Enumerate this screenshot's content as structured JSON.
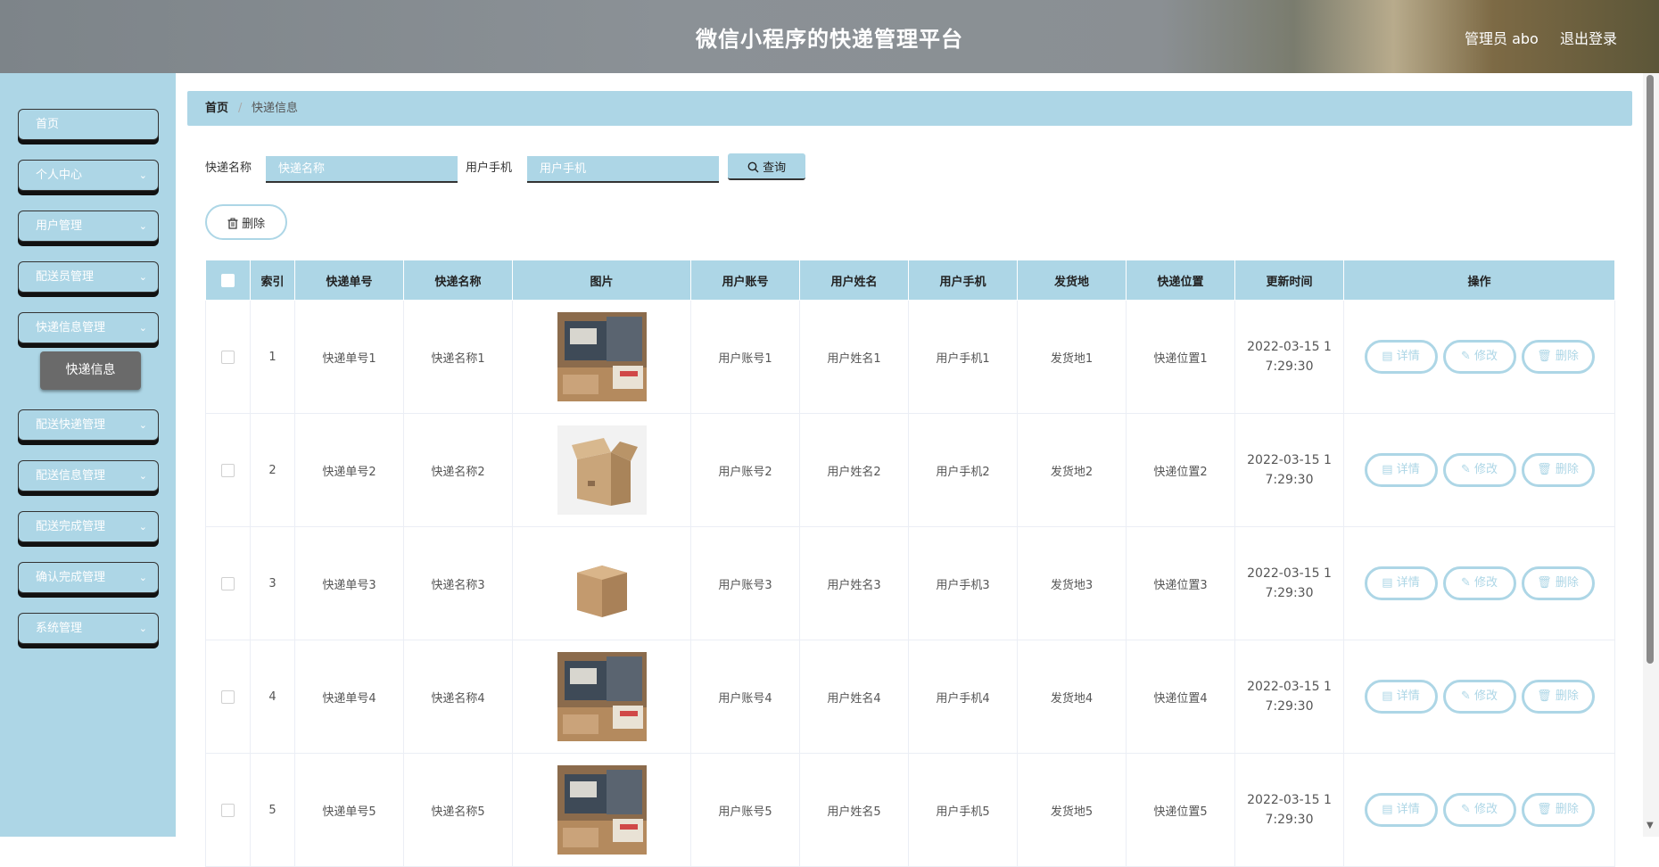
{
  "header": {
    "title": "微信小程序的快递管理平台",
    "admin_label": "管理员 abo",
    "logout_label": "退出登录"
  },
  "sidebar": {
    "items": [
      {
        "label": "首页",
        "has_children": false
      },
      {
        "label": "个人中心",
        "has_children": true
      },
      {
        "label": "用户管理",
        "has_children": true
      },
      {
        "label": "配送员管理",
        "has_children": true
      },
      {
        "label": "快递信息管理",
        "has_children": true
      },
      {
        "label": "配送快递管理",
        "has_children": true
      },
      {
        "label": "配送信息管理",
        "has_children": true
      },
      {
        "label": "配送完成管理",
        "has_children": true
      },
      {
        "label": "确认完成管理",
        "has_children": true
      },
      {
        "label": "系统管理",
        "has_children": true
      }
    ],
    "active_sub_item": "快递信息"
  },
  "breadcrumb": {
    "home": "首页",
    "separator": "/",
    "current": "快递信息"
  },
  "search": {
    "name_label": "快递名称",
    "name_placeholder": "快递名称",
    "phone_label": "用户手机",
    "phone_placeholder": "用户手机",
    "query_label": "查询"
  },
  "actions": {
    "delete_label": "删除"
  },
  "table": {
    "headers": [
      "索引",
      "快递单号",
      "快递名称",
      "图片",
      "用户账号",
      "用户姓名",
      "用户手机",
      "发货地",
      "快递位置",
      "更新时间",
      "操作"
    ],
    "rows": [
      {
        "index": "1",
        "number": "快递单号1",
        "name": "快递名称1",
        "image": "parcel-photo",
        "account": "用户账号1",
        "username": "用户姓名1",
        "phone": "用户手机1",
        "origin": "发货地1",
        "location": "快递位置1",
        "time_a": "2022-03-15 1",
        "time_b": "7:29:30"
      },
      {
        "index": "2",
        "number": "快递单号2",
        "name": "快递名称2",
        "image": "box-open",
        "account": "用户账号2",
        "username": "用户姓名2",
        "phone": "用户手机2",
        "origin": "发货地2",
        "location": "快递位置2",
        "time_a": "2022-03-15 1",
        "time_b": "7:29:30"
      },
      {
        "index": "3",
        "number": "快递单号3",
        "name": "快递名称3",
        "image": "box-closed",
        "account": "用户账号3",
        "username": "用户姓名3",
        "phone": "用户手机3",
        "origin": "发货地3",
        "location": "快递位置3",
        "time_a": "2022-03-15 1",
        "time_b": "7:29:30"
      },
      {
        "index": "4",
        "number": "快递单号4",
        "name": "快递名称4",
        "image": "parcel-photo",
        "account": "用户账号4",
        "username": "用户姓名4",
        "phone": "用户手机4",
        "origin": "发货地4",
        "location": "快递位置4",
        "time_a": "2022-03-15 1",
        "time_b": "7:29:30"
      },
      {
        "index": "5",
        "number": "快递单号5",
        "name": "快递名称5",
        "image": "parcel-photo",
        "account": "用户账号5",
        "username": "用户姓名5",
        "phone": "用户手机5",
        "origin": "发货地5",
        "location": "快递位置5",
        "time_a": "2022-03-15 1",
        "time_b": "7:29:30"
      }
    ],
    "row_actions": {
      "detail": "详情",
      "edit": "修改",
      "delete": "删除"
    }
  },
  "colors": {
    "accent": "#add6e6",
    "header_bg": "#8a8f93",
    "active_sub": "#6a6a6a"
  },
  "icons": {
    "query": "search-icon",
    "delete": "trash-icon",
    "detail": "document-icon",
    "edit": "pencil-icon",
    "menu_expand": "chevron-down-icon"
  }
}
